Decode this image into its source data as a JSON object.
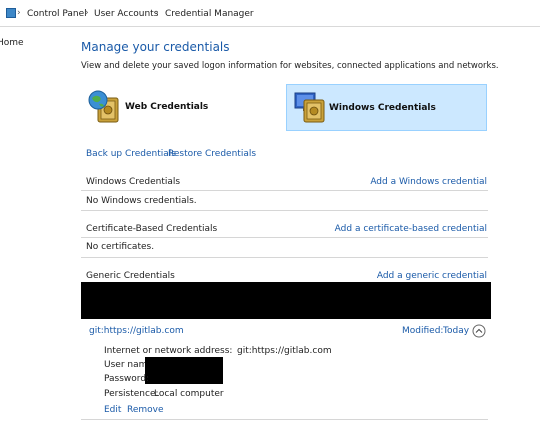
{
  "breadcrumb": {
    "items": [
      "Control Panel",
      "User Accounts",
      "Credential Manager"
    ]
  },
  "sidebar": {
    "home_label": "Home"
  },
  "main": {
    "title": "Manage your credentials",
    "description": "View and delete your saved logon information for websites, connected applications and networks.",
    "cards": [
      {
        "label": "Web Credentials",
        "selected": false
      },
      {
        "label": "Windows Credentials",
        "selected": true
      }
    ],
    "backup_link": "Back up Credentials",
    "restore_link": "Restore Credentials"
  },
  "sections": {
    "windows": {
      "title": "Windows Credentials",
      "add_link": "Add a Windows credential",
      "empty_text": "No Windows credentials."
    },
    "certificate": {
      "title": "Certificate-Based Credentials",
      "add_link": "Add a certificate-based credential",
      "empty_text": "No certificates."
    },
    "generic": {
      "title": "Generic Credentials",
      "add_link": "Add a generic credential"
    }
  },
  "credential": {
    "name": "git:https://gitlab.com",
    "modified_label": "Modified:",
    "modified_value": "Today",
    "address_label": "Internet or network address:",
    "address_value": "git:https://gitlab.com",
    "username_label": "User name",
    "password_label": "Password:",
    "persistence_label": "Persistence:",
    "persistence_value": "Local computer",
    "edit_link": "Edit",
    "remove_link": "Remove"
  },
  "colors": {
    "link": "#1a5aa8",
    "title": "#1a5aa8",
    "selected_bg": "#cce8ff",
    "selected_border": "#99d1ff"
  },
  "icons": {
    "web": "globe-vault-icon",
    "windows": "monitor-vault-icon",
    "collapse": "chevron-up-circle-icon"
  }
}
